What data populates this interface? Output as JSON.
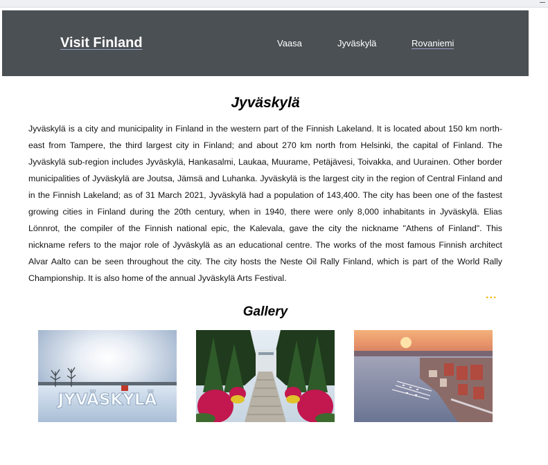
{
  "header": {
    "brand": "Visit Finland",
    "nav": [
      {
        "label": "Vaasa"
      },
      {
        "label": "Jyväskylä"
      },
      {
        "label": "Rovaniemi"
      }
    ]
  },
  "main": {
    "title": "Jyväskylä",
    "body": "Jyväskylä is a city and municipality in Finland in the western part of the Finnish Lakeland. It is located about 150 km north-east from Tampere, the third largest city in Finland; and about 270 km north from Helsinki, the capital of Finland. The Jyväskylä sub-region includes Jyväskylä, Hankasalmi, Laukaa, Muurame, Petäjävesi, Toivakka, and Uurainen. Other border municipalities of Jyväskylä are Joutsa, Jämsä and Luhanka. Jyväskylä is the largest city in the region of Central Finland and in the Finnish Lakeland; as of 31 March 2021, Jyväskylä had a population of 143,400. The city has been one of the fastest growing cities in Finland during the 20th century, when in 1940, there were only 8,000 inhabitants in Jyväskylä. Elias Lönnrot, the compiler of the Finnish national epic, the Kalevala, gave the city the nickname \"Athens of Finland\". This nickname refers to the major role of Jyväskylä as an educational centre. The works of the most famous Finnish architect Alvar Aalto can be seen throughout the city. The city hosts the Neste Oil Rally Finland, which is part of the World Rally Championship. It is also home of the annual Jyväskylä Arts Festival.",
    "more": "..."
  },
  "gallery": {
    "title": "Gallery",
    "sign_text": "JYVÄSKYLÄ"
  },
  "colors": {
    "navbar_bg": "#4b5054",
    "more_dots": "#f2b705"
  }
}
